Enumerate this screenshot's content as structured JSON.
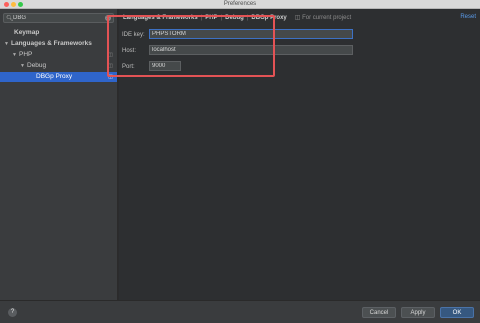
{
  "window": {
    "title": "Preferences"
  },
  "sidebar": {
    "search": {
      "value": "DBG"
    },
    "items": [
      {
        "label": "Keymap",
        "expanded": null
      },
      {
        "label": "Languages & Frameworks",
        "expanded": true
      },
      {
        "label": "PHP",
        "expanded": true
      },
      {
        "label": "Debug",
        "expanded": true
      },
      {
        "label": "DBGp Proxy",
        "expanded": null,
        "selected": true
      }
    ]
  },
  "main": {
    "breadcrumb": [
      "Languages & Frameworks",
      "PHP",
      "Debug",
      "DBGp Proxy"
    ],
    "scope_label": "For current project",
    "reset_label": "Reset",
    "fields": [
      {
        "label": "IDE key:",
        "value": "PHPSTORM",
        "focused": true
      },
      {
        "label": "Host:",
        "value": "localhost"
      },
      {
        "label": "Port:",
        "value": "9000"
      }
    ]
  },
  "footer": {
    "help": "?",
    "cancel_label": "Cancel",
    "apply_label": "Apply",
    "ok_label": "OK"
  },
  "colors": {
    "accent": "#2f65ca",
    "highlight": "#e35355",
    "link": "#5a9bea"
  }
}
